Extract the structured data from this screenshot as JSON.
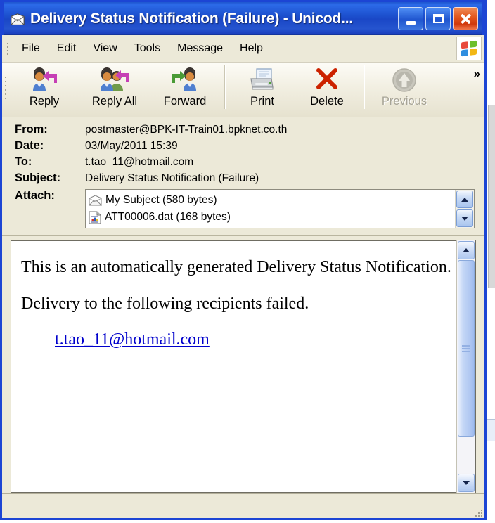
{
  "window": {
    "title": "Delivery Status Notification (Failure) - Unicod...",
    "title_icon": "envelope-icon",
    "minimize_label": "Minimize",
    "maximize_label": "Maximize",
    "close_label": "Close"
  },
  "menu": {
    "items": [
      {
        "label": "File"
      },
      {
        "label": "Edit"
      },
      {
        "label": "View"
      },
      {
        "label": "Tools"
      },
      {
        "label": "Message"
      },
      {
        "label": "Help"
      }
    ],
    "brand_icon": "windows-flag-icon"
  },
  "toolbar": {
    "overflow_label": "»",
    "buttons": [
      {
        "label": "Reply",
        "icon": "reply-icon",
        "disabled": false
      },
      {
        "label": "Reply All",
        "icon": "reply-all-icon",
        "disabled": false
      },
      {
        "label": "Forward",
        "icon": "forward-icon",
        "disabled": false
      },
      {
        "label": "Print",
        "icon": "printer-icon",
        "disabled": false
      },
      {
        "label": "Delete",
        "icon": "delete-x-icon",
        "disabled": false
      },
      {
        "label": "Previous",
        "icon": "previous-up-arrow-icon",
        "disabled": true
      }
    ]
  },
  "headers": {
    "from_label": "From:",
    "from_value": "postmaster@BPK-IT-Train01.bpknet.co.th",
    "date_label": "Date:",
    "date_value": "03/May/2011 15:39",
    "to_label": "To:",
    "to_value": "t.tao_11@hotmail.com",
    "subject_label": "Subject:",
    "subject_value": "Delivery Status Notification (Failure)",
    "attach_label": "Attach:"
  },
  "attachments": [
    {
      "name": "My Subject (580 bytes)",
      "icon": "envelope-attachment-icon"
    },
    {
      "name": "ATT00006.dat (168 bytes)",
      "icon": "dat-file-icon"
    }
  ],
  "body": {
    "paragraph1": "This is an automatically generated Delivery Status Notification.",
    "paragraph2": "Delivery to the following recipients failed.",
    "recipient_link": "t.tao_11@hotmail.com"
  },
  "colors": {
    "title_bar_blue": "#1d51cf",
    "window_border_blue": "#1c45d4",
    "chrome_beige": "#ECE9D8",
    "close_button_orange": "#e2551c",
    "link_blue": "#0000cc",
    "delete_red": "#cc2200"
  },
  "scrollbars": {
    "attach_up": "scroll-up",
    "attach_down": "scroll-down",
    "body_up": "scroll-up",
    "body_down": "scroll-down"
  }
}
